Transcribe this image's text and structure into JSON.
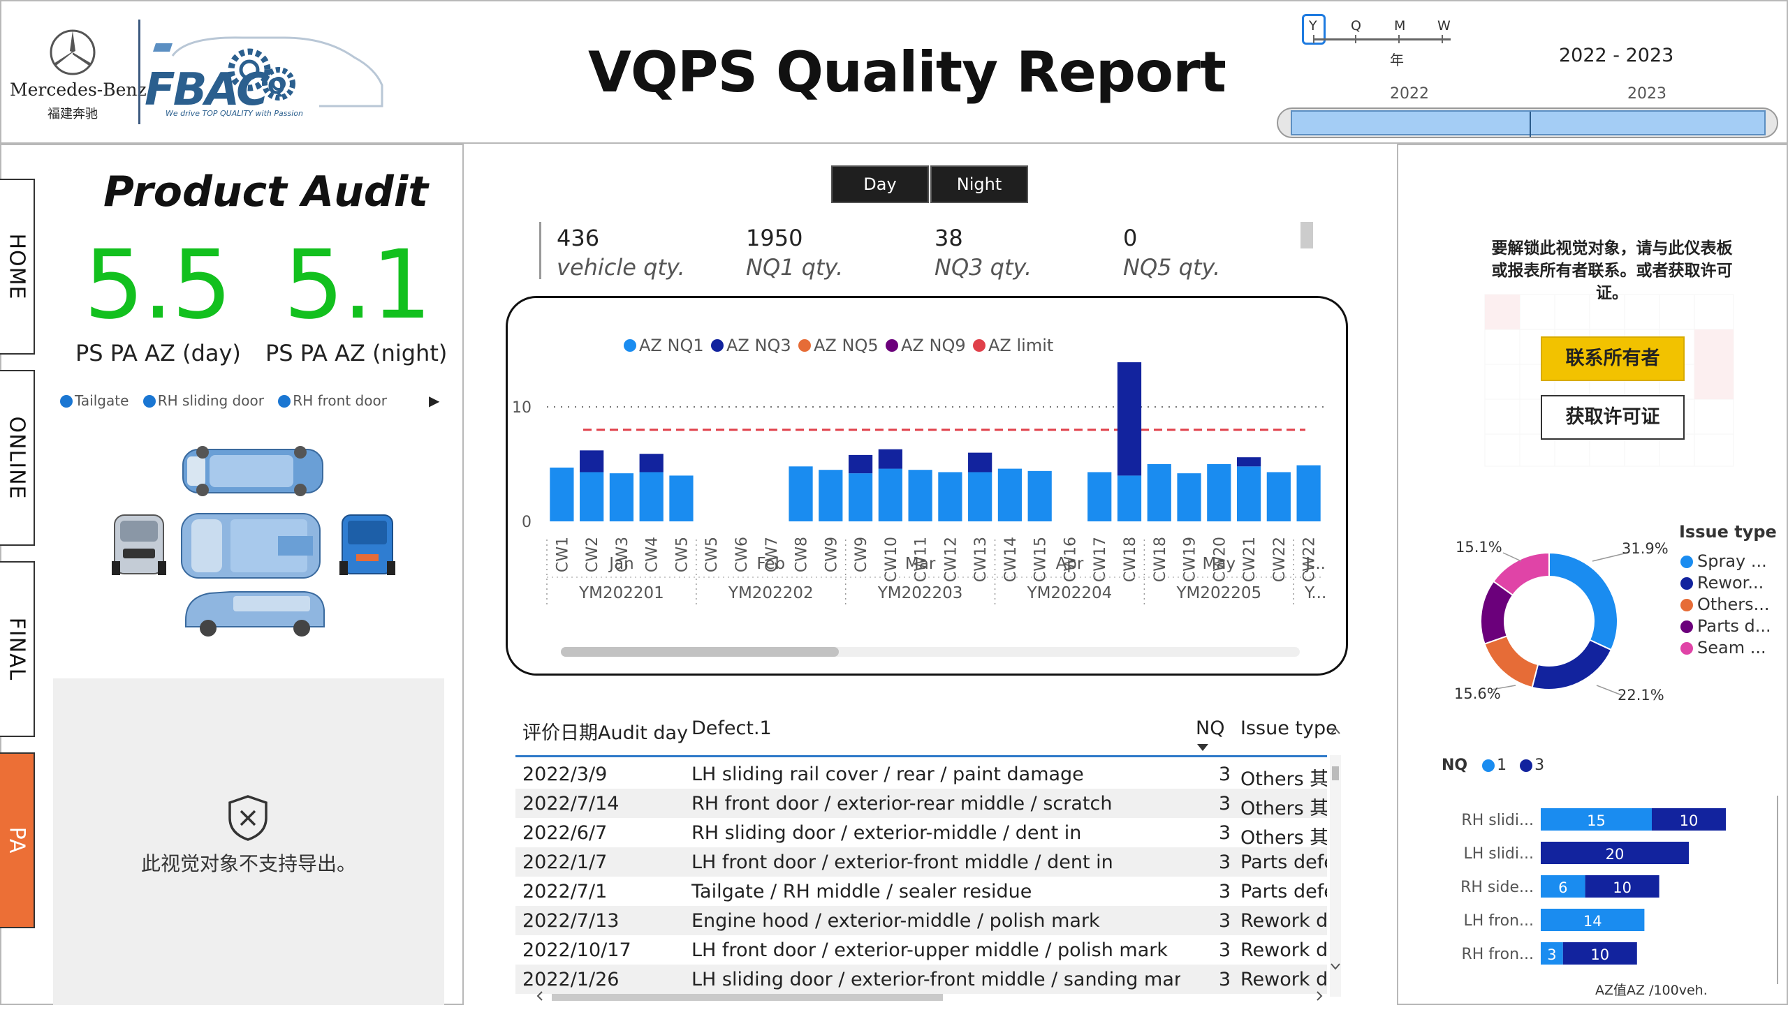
{
  "header": {
    "brand": "Mercedes-Benz",
    "brand_cn": "福建奔驰",
    "fbac_logo": "FBAC",
    "fbac_slogan": "We drive TOP QUALITY with Passion",
    "title": "VQPS Quality Report"
  },
  "date_slicer": {
    "periods": [
      "Y",
      "Q",
      "M",
      "W"
    ],
    "selected_period": "Y",
    "period_caption": "年",
    "range_label": "2022 - 2023",
    "years": [
      "2022",
      "2023"
    ]
  },
  "nav": {
    "home": "HOME",
    "online": "ONLINE",
    "final": "FINAL",
    "pa": "PA",
    "active": "PA"
  },
  "left": {
    "title": "Product Audit",
    "kpi_day": {
      "value": "5.5",
      "label": "PS PA AZ (day)"
    },
    "kpi_night": {
      "value": "5.1",
      "label": "PS PA AZ (night)"
    },
    "legend": [
      "Tailgate",
      "RH sliding door",
      "RH front door"
    ],
    "legend_arrow": "▶",
    "export_msg": "此视觉对象不支持导出。"
  },
  "center": {
    "shift_buttons": [
      "Day",
      "Night"
    ],
    "stats": [
      {
        "value": "436",
        "label": "vehicle qty."
      },
      {
        "value": "1950",
        "label": "NQ1 qty."
      },
      {
        "value": "38",
        "label": "NQ3 qty."
      },
      {
        "value": "0",
        "label": "NQ5 qty."
      }
    ]
  },
  "chart_data": {
    "type": "bar",
    "legend": [
      {
        "name": "AZ NQ1",
        "color": "#1a8cf0"
      },
      {
        "name": "AZ NQ3",
        "color": "#12239e"
      },
      {
        "name": "AZ NQ5",
        "color": "#e66c37"
      },
      {
        "name": "AZ NQ9",
        "color": "#6b007b"
      },
      {
        "name": "AZ  limit",
        "color": "#e0404a"
      }
    ],
    "y_ticks": [
      0,
      10
    ],
    "ylim": [
      0,
      15
    ],
    "limit": 8,
    "categories": [
      "CW1",
      "CW2",
      "CW3",
      "CW4",
      "CW5",
      "CW5",
      "CW6",
      "CW7",
      "CW8",
      "CW9",
      "CW9",
      "CW10",
      "CW11",
      "CW12",
      "CW13",
      "CW14",
      "CW15",
      "CW16",
      "CW17",
      "CW18",
      "CW18",
      "CW19",
      "CW20",
      "CW21",
      "CW22",
      "CW22"
    ],
    "series": [
      {
        "name": "AZ NQ1",
        "values": [
          4.7,
          4.3,
          4.2,
          4.3,
          4.0,
          0,
          0,
          0,
          4.8,
          4.5,
          4.2,
          4.6,
          4.5,
          4.3,
          4.3,
          4.6,
          4.4,
          0,
          4.3,
          4.0,
          5.0,
          4.2,
          5.0,
          4.8,
          4.3,
          4.9
        ]
      },
      {
        "name": "AZ NQ3",
        "values": [
          0,
          1.9,
          0,
          1.6,
          0,
          0,
          0,
          0,
          0,
          0,
          1.6,
          1.7,
          0,
          0,
          1.7,
          0,
          0,
          0,
          0,
          9.9,
          0,
          0,
          0,
          0.8,
          0,
          0
        ]
      }
    ],
    "months": [
      "Jan",
      "Feb",
      "Mar",
      "Apr",
      "May",
      "J..."
    ],
    "month_keys": [
      "YM202201",
      "YM202202",
      "YM202203",
      "YM202204",
      "YM202205",
      "Y..."
    ]
  },
  "table": {
    "headers": [
      "评价日期Audit day",
      "Defect.1",
      "NQ",
      "Issue type"
    ],
    "rows": [
      [
        "2022/3/9",
        "LH sliding rail cover / rear / paint damage",
        "3",
        "Others 其他"
      ],
      [
        "2022/7/14",
        "RH front door / exterior-rear middle / scratch",
        "3",
        "Others 其他"
      ],
      [
        "2022/6/7",
        "RH sliding door / exterior-middle / dent in",
        "3",
        "Others 其他"
      ],
      [
        "2022/1/7",
        "LH front door / exterior-front middle / dent in",
        "3",
        "Parts defec"
      ],
      [
        "2022/7/1",
        "Tailgate / RH middle / sealer residue",
        "3",
        "Parts defec"
      ],
      [
        "2022/7/13",
        "Engine hood / exterior-middle / polish mark",
        "3",
        "Rework def"
      ],
      [
        "2022/10/17",
        "LH front door / exterior-upper middle / polish mark",
        "3",
        "Rework def"
      ],
      [
        "2022/1/26",
        "LH sliding door / exterior-front middle / sanding mark",
        "3",
        "Rework def"
      ]
    ]
  },
  "right": {
    "locked_msg": "要解锁此视觉对象，请与此仪表板或报表所有者联系。或者获取许可证。",
    "btn_contact": "联系所有者",
    "btn_license": "获取许可证",
    "donut": {
      "title": "Issue type",
      "slices": [
        {
          "label": "Spray ...",
          "value": 31.9,
          "color": "#1a8cf0"
        },
        {
          "label": "Rewor...",
          "value": 22.1,
          "color": "#12239e"
        },
        {
          "label": "Others...",
          "value": 15.6,
          "color": "#e66c37"
        },
        {
          "label": "Parts d...",
          "value": 15.3,
          "color": "#6b007b"
        },
        {
          "label": "Seam ...",
          "value": 15.1,
          "color": "#e044a7"
        }
      ],
      "pct_labels": [
        "31.9%",
        "22.1%",
        "15.6%",
        "15.1%"
      ]
    },
    "nq_chart": {
      "legend_title": "NQ",
      "legend": [
        {
          "name": "1",
          "color": "#1a8cf0"
        },
        {
          "name": "3",
          "color": "#12239e"
        }
      ],
      "rows": [
        {
          "label": "RH slidi...",
          "nq1": 15,
          "nq3": 10
        },
        {
          "label": "LH slidi...",
          "nq1": 0,
          "nq3": 20
        },
        {
          "label": "RH side...",
          "nq1": 6,
          "nq3": 10
        },
        {
          "label": "LH fron...",
          "nq1": 14,
          "nq3": 0
        },
        {
          "label": "RH fron...",
          "nq1": 3,
          "nq3": 10
        }
      ],
      "footer": "AZ值AZ /100veh."
    }
  }
}
